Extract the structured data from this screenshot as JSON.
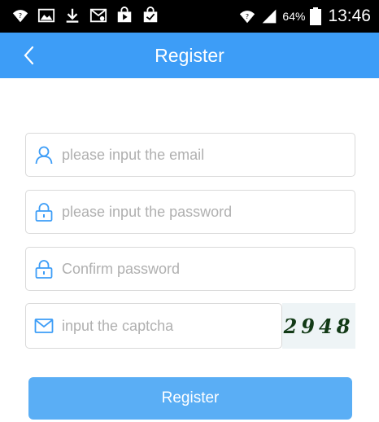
{
  "status_bar": {
    "battery_percent": "64%",
    "time": "13:46",
    "icons": [
      "wifi-question-icon",
      "image-icon",
      "download-icon",
      "image-mail-icon",
      "store-play-icon",
      "store-check-icon"
    ]
  },
  "nav": {
    "title": "Register",
    "back_icon": "chevron-left-icon"
  },
  "form": {
    "email": {
      "placeholder": "please input the email",
      "value": "",
      "icon": "user-icon"
    },
    "password": {
      "placeholder": "please input the password",
      "value": "",
      "icon": "lock-icon"
    },
    "confirm": {
      "placeholder": "Confirm password",
      "value": "",
      "icon": "lock-icon"
    },
    "captcha": {
      "placeholder": "input the captcha",
      "value": "",
      "icon": "mail-icon",
      "image_text": "2948"
    },
    "submit_label": "Register"
  },
  "colors": {
    "primary": "#3d9df7",
    "button": "#5aaef5",
    "icon": "#3d9df7",
    "border": "#d9d9d9",
    "placeholder": "#b0b0b0"
  }
}
